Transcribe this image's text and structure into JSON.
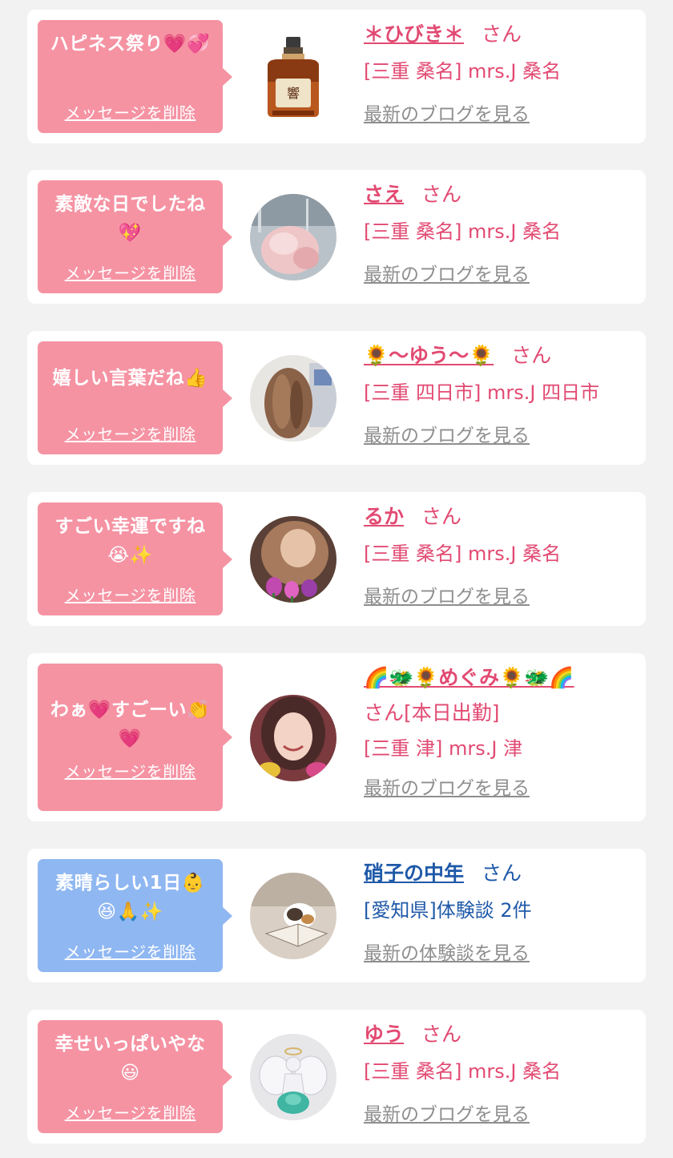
{
  "cards": [
    {
      "message": "ハピネス祭り💗💞",
      "delete_label": "メッセージを削除",
      "name": "＊ひびき＊",
      "honorific": "さん",
      "extra": "",
      "shop": "[三重 桑名] mrs.J 桑名",
      "blog_link": "最新のブログを見る",
      "bubble_color": "#f593a3",
      "avatar": "whisky-bottle"
    },
    {
      "message": "素敵な日でしたね💖",
      "delete_label": "メッセージを削除",
      "name": "さえ",
      "honorific": "さん",
      "extra": "",
      "shop": "[三重 桑名] mrs.J 桑名",
      "blog_link": "最新のブログを見る",
      "bubble_color": "#f593a3",
      "avatar": "pink-clothes-photo"
    },
    {
      "message": "嬉しい言葉だね👍",
      "delete_label": "メッセージを削除",
      "name": "🌻〜ゆう〜🌻",
      "honorific": "さん",
      "extra": "",
      "shop": "[三重 四日市] mrs.J 四日市",
      "blog_link": "最新のブログを見る",
      "bubble_color": "#f593a3",
      "avatar": "hair-photo"
    },
    {
      "message": "すごい幸運ですね😭✨",
      "delete_label": "メッセージを削除",
      "name": "るか",
      "honorific": "さん",
      "extra": "",
      "shop": "[三重 桑名] mrs.J 桑名",
      "blog_link": "最新のブログを見る",
      "bubble_color": "#f593a3",
      "avatar": "tulip-photo"
    },
    {
      "message": "わぁ💗すごーい👏💗",
      "delete_label": "メッセージを削除",
      "name": "🌈🐲🌻めぐみ🌻🐲🌈",
      "honorific": "さん",
      "extra": "[本日出勤]",
      "shop": "[三重 津] mrs.J 津",
      "blog_link": "最新のブログを見る",
      "bubble_color": "#f593a3",
      "avatar": "smiling-woman-photo"
    },
    {
      "message": "素晴らしい1日👶😆🙏✨",
      "delete_label": "メッセージを削除",
      "name": "硝子の中年",
      "honorific": "さん",
      "extra": "",
      "shop": "[愛知県]体験談 2件",
      "blog_link": "最新の体験談を見る",
      "bubble_color": "#8fb7f2",
      "avatar": "cat-photo"
    },
    {
      "message": "幸せいっぱいやな😃",
      "delete_label": "メッセージを削除",
      "name": "ゆう",
      "honorific": "さん",
      "extra": "",
      "shop": "[三重 桑名] mrs.J 桑名",
      "blog_link": "最新のブログを見る",
      "bubble_color": "#f593a3",
      "avatar": "angel-figurine-photo"
    }
  ]
}
